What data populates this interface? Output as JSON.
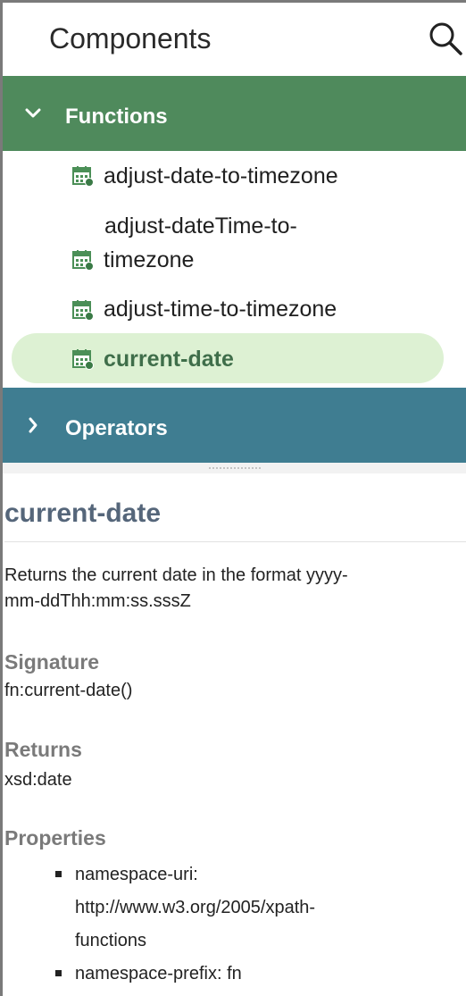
{
  "panel": {
    "title": "Components",
    "search_icon": "search-icon"
  },
  "groups": {
    "functions": {
      "label": "Functions",
      "expanded": true,
      "color": "#4f8a5c"
    },
    "operators": {
      "label": "Operators",
      "expanded": false,
      "color": "#3f7d91"
    }
  },
  "functions": [
    {
      "label_lines": [
        "adjust-date-to-timezone"
      ],
      "icon": "calendar-function-icon",
      "selected": false
    },
    {
      "label_lines": [
        "adjust-dateTime-to-",
        "timezone"
      ],
      "icon": "calendar-function-icon",
      "selected": false
    },
    {
      "label_lines": [
        "adjust-time-to-timezone"
      ],
      "icon": "calendar-function-icon",
      "selected": false
    },
    {
      "label_lines": [
        "current-date"
      ],
      "icon": "calendar-function-icon",
      "selected": true,
      "highlight_color": "#ddf1d3"
    }
  ],
  "detail": {
    "title": "current-date",
    "description_lines": [
      "Returns the current date in the format yyyy-",
      "mm-ddThh:mm:ss.sssZ"
    ],
    "signature_heading": "Signature",
    "signature_value": "fn:current-date()",
    "returns_heading": "Returns",
    "returns_value": "xsd:date",
    "properties_heading": "Properties",
    "properties": [
      {
        "lines": [
          "namespace-uri:",
          "http://www.w3.org/2005/xpath-",
          "functions"
        ]
      },
      {
        "lines": [
          "namespace-prefix: fn"
        ]
      }
    ]
  }
}
